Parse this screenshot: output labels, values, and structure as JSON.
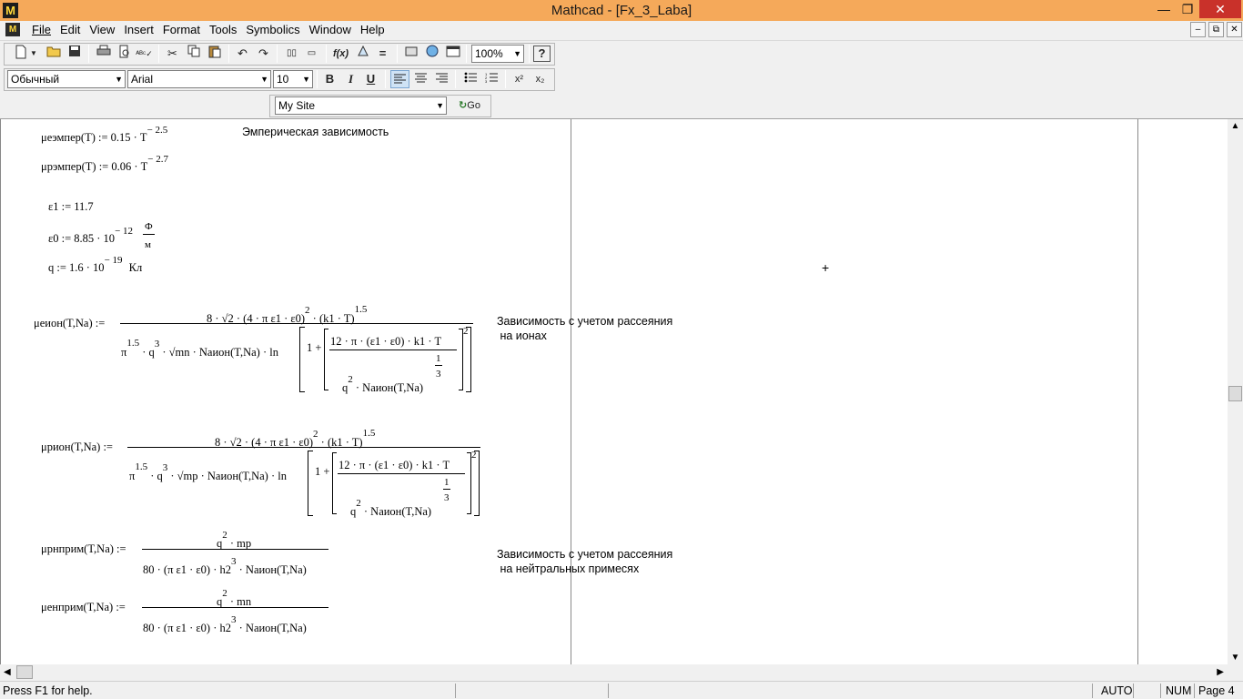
{
  "window": {
    "title": "Mathcad - [Fx_3_Laba]",
    "min": "—",
    "max": "❐",
    "close": "✕",
    "app_glyph": "M"
  },
  "menu": {
    "items": [
      "File",
      "Edit",
      "View",
      "Insert",
      "Format",
      "Tools",
      "Symbolics",
      "Window",
      "Help"
    ],
    "mdi_min": "–",
    "mdi_restore": "⧉",
    "mdi_close": "✕"
  },
  "toolbar": {
    "zoom": "100%",
    "style": "Обычный",
    "font": "Arial",
    "size": "10",
    "bold": "B",
    "italic": "I",
    "underline": "U",
    "sup": "x²",
    "sub": "x₂",
    "fx": "f(x)",
    "help": "?",
    "site": "My Site",
    "go": "Go"
  },
  "worksheet": {
    "eq1_lhs": "μeэмпер(T) := 0.15 · T",
    "eq1_exp": "− 2.5",
    "eq1_note": "Эмперическая зависимость",
    "eq2_lhs": "μpэмпер(T) := 0.06 · T",
    "eq2_exp": "− 2.7",
    "eps1": "ε1 := 11.7",
    "eps0_lhs": "ε0 := 8.85 · 10",
    "eps0_exp": "− 12",
    "eps0_unit_num": "Ф",
    "eps0_unit_den": "м",
    "q_lhs": "q := 1.6 · 10",
    "q_exp": "− 19",
    "q_unit": "Кл",
    "ion_e_lhs": "μeион(T,Na) :=",
    "ion_p_lhs": "μpион(T,Na) :=",
    "ion_num_a": "8 · √2 · (4 · π ε1 · ε0)",
    "ion_num_exp": "2",
    "ion_num_b": "· (k1 · T)",
    "ion_num_exp2": "1.5",
    "ion_den_pi": "π",
    "ion_den_pi_exp": "1.5",
    "ion_den_q": "· q",
    "ion_den_q_exp": "3",
    "ion_den_e_rest": "· √mn · Naион(T,Na) · ln",
    "ion_den_p_rest": "· √mp · Naион(T,Na) · ln",
    "ion_one": "1 +",
    "ion_inner_e_num": "12 · π · (ε1 · ε0) · k1 · T",
    "ion_inner_p_num": "12 · π · (ε1 · ε0) · k1 · T",
    "ion_inner_frac_num": "1",
    "ion_inner_frac_den": "3",
    "ion_inner_den": "q",
    "ion_inner_den_exp": "2",
    "ion_inner_den_rest": "· Naион(T,Na)",
    "ion_outer_exp": "2",
    "note_ion_line1": "Зависимость с учетом рассеяния",
    "note_ion_line2": " на ионах",
    "nprim_p_lhs": "μpнприм(T,Na) :=",
    "nprim_e_lhs": "μeнприм(T,Na) :=",
    "nprim_p_num": "q",
    "nprim_num_exp": "2",
    "nprim_p_num_rest": "· mp",
    "nprim_e_num_rest": "· mn",
    "nprim_den": "80 · (π ε1 · ε0) · h2",
    "nprim_den_exp": "3",
    "nprim_den_rest": "· Naион(T,Na)",
    "note_nprim_line1": "Зависимость с учетом рассеяния",
    "note_nprim_line2": " на нейтральных примесях",
    "cursor": "+"
  },
  "status": {
    "help": "Press F1 for help.",
    "auto": "AUTO",
    "num": "NUM",
    "page": "Page 4"
  }
}
